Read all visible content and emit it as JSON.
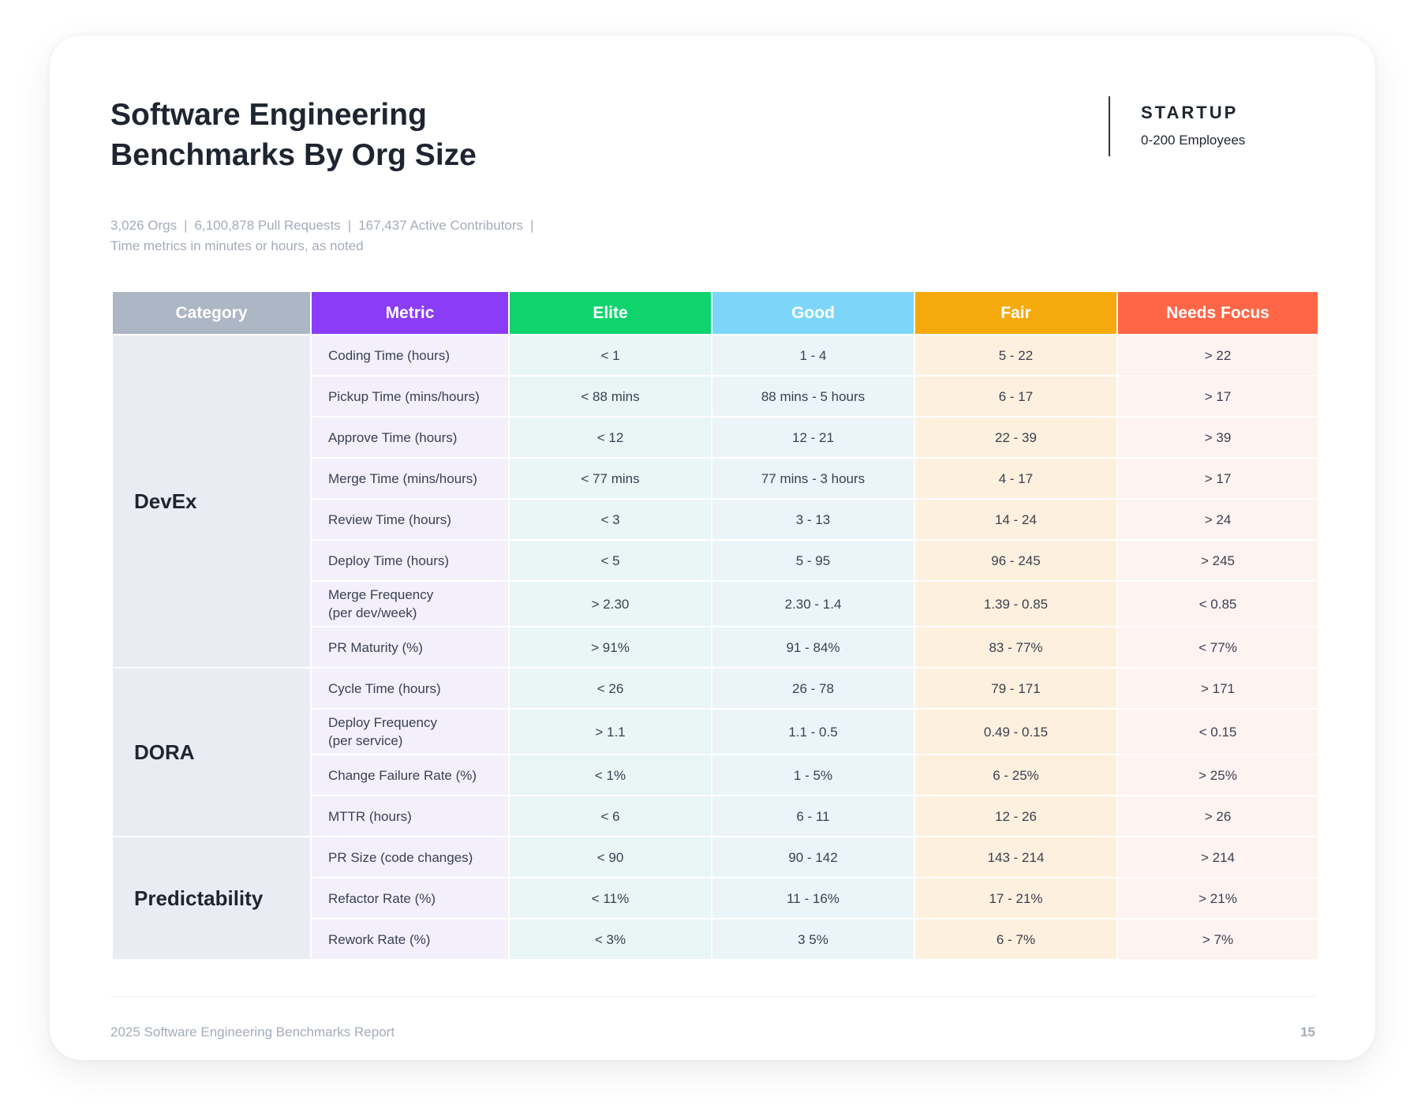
{
  "title": {
    "line1": "Software Engineering",
    "line2": "Benchmarks By Org Size"
  },
  "org": {
    "name": "STARTUP",
    "sub": "0-200 Employees"
  },
  "stats": {
    "items": [
      "3,026 Orgs",
      "6,100,878 Pull Requests",
      "167,437 Active Contributors"
    ],
    "separator": "|",
    "note": "Time metrics in minutes or hours, as noted"
  },
  "table": {
    "headers": [
      "Category",
      "Metric",
      "Elite",
      "Good",
      "Fair",
      "Needs Focus"
    ],
    "header_colors": [
      "#adb6c4",
      "#8b3cf7",
      "#0fd46e",
      "#7dd6fa",
      "#f5a90d",
      "#ff6647"
    ],
    "groups": [
      {
        "name": "DevEx",
        "rows": [
          {
            "metric": [
              "Coding Time (hours)"
            ],
            "elite": "< 1",
            "good": "1 - 4",
            "fair": "5 - 22",
            "needs": "> 22"
          },
          {
            "metric": [
              "Pickup Time (mins/hours)"
            ],
            "elite": "< 88 mins",
            "good": "88 mins - 5 hours",
            "fair": "6 - 17",
            "needs": "> 17"
          },
          {
            "metric": [
              "Approve Time (hours)"
            ],
            "elite": "< 12",
            "good": "12 - 21",
            "fair": "22 - 39",
            "needs": "> 39"
          },
          {
            "metric": [
              "Merge Time (mins/hours)"
            ],
            "elite": "< 77 mins",
            "good": "77 mins - 3 hours",
            "fair": "4 - 17",
            "needs": "> 17"
          },
          {
            "metric": [
              "Review Time (hours)"
            ],
            "elite": "< 3",
            "good": "3 - 13",
            "fair": "14 - 24",
            "needs": "> 24"
          },
          {
            "metric": [
              "Deploy Time (hours)"
            ],
            "elite": "< 5",
            "good": "5 - 95",
            "fair": "96 - 245",
            "needs": "> 245"
          },
          {
            "metric": [
              "Merge Frequency",
              "(per dev/week)"
            ],
            "elite": "> 2.30",
            "good": "2.30 - 1.4",
            "fair": "1.39 - 0.85",
            "needs": "< 0.85"
          },
          {
            "metric": [
              "PR Maturity (%)"
            ],
            "elite": "> 91%",
            "good": "91 - 84%",
            "fair": "83 - 77%",
            "needs": "< 77%"
          }
        ]
      },
      {
        "name": "DORA",
        "rows": [
          {
            "metric": [
              "Cycle Time (hours)"
            ],
            "elite": "< 26",
            "good": "26 - 78",
            "fair": "79 - 171",
            "needs": "> 171"
          },
          {
            "metric": [
              "Deploy Frequency",
              "(per service)"
            ],
            "elite": "> 1.1",
            "good": "1.1 - 0.5",
            "fair": "0.49 - 0.15",
            "needs": "< 0.15"
          },
          {
            "metric": [
              "Change Failure Rate (%)"
            ],
            "elite": "< 1%",
            "good": "1 - 5%",
            "fair": "6 - 25%",
            "needs": "> 25%"
          },
          {
            "metric": [
              "MTTR (hours)"
            ],
            "elite": "< 6",
            "good": "6 - 11",
            "fair": "12 - 26",
            "needs": "> 26"
          }
        ]
      },
      {
        "name": "Predictability",
        "rows": [
          {
            "metric": [
              "PR Size (code changes)"
            ],
            "elite": "< 90",
            "good": "90 - 142",
            "fair": "143 - 214",
            "needs": "> 214"
          },
          {
            "metric": [
              "Refactor Rate (%)"
            ],
            "elite": "< 11%",
            "good": "11 - 16%",
            "fair": "17 - 21%",
            "needs": "> 21%"
          },
          {
            "metric": [
              "Rework Rate (%)"
            ],
            "elite": "< 3%",
            "good": "3  5%",
            "fair": "6 - 7%",
            "needs": "> 7%"
          }
        ]
      }
    ]
  },
  "footer": {
    "text": "2025 Software Engineering Benchmarks Report",
    "page": "15"
  }
}
